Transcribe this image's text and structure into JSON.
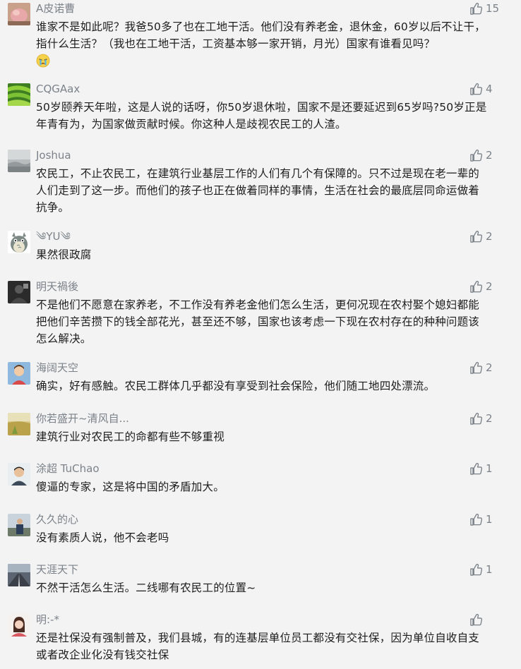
{
  "comments": [
    {
      "name": "A皮诺曹",
      "likes": "15",
      "content": "谁家不是如此呢？我爸50多了也在工地干活。他们没有养老金，退休金，60岁以后不让干，指什么生活？（我也在工地干活，工资基本够一家开销，月光）国家有谁看见吗？",
      "emoji": "crying-face-emoji",
      "avatar": "avatar-pink-object"
    },
    {
      "name": "CQGAax",
      "likes": "4",
      "content": "50岁颐养天年啦，这是人说的话呀，你50岁退休啦，国家不是还要延迟到65岁吗?50岁正是年青有为，为国家做贡献时候。你这种人是歧视农民工的人渣。",
      "avatar": "avatar-green-fields"
    },
    {
      "name": "Joshua",
      "likes": "2",
      "content": "农民工，不止农民工，在建筑行业基层工作的人们有几个有保障的。只不过是现在老一辈的人们走到了这一步。而他们的孩子也正在做着同样的事情，生活在社会的最底层同命运做着抗争。",
      "avatar": "avatar-grey-landscape"
    },
    {
      "name": "༄YU༄",
      "likes": "2",
      "content": "果然很政腐",
      "avatar": "avatar-totoro"
    },
    {
      "name": "明天禍後",
      "likes": "2",
      "content": "不是他们不愿意在家养老，不工作没有养老金他们怎么生活，更何况现在农村娶个媳妇都能把他们辛苦攒下的钱全部花光，甚至还不够，国家也该考虑一下现在农村存在的种种问题该怎么解决。",
      "avatar": "avatar-dark-figure"
    },
    {
      "name": "海阔天空",
      "likes": "2",
      "content": "确实，好有感触。农民工群体几乎都没有享受到社会保险，他们随工地四处漂流。",
      "avatar": "avatar-child-photo"
    },
    {
      "name": "你若盛开~清风自...",
      "likes": "2",
      "content": "建筑行业对农民工的命都有些不够重视",
      "avatar": "avatar-yellow-field"
    },
    {
      "name": "涂超 TuChao",
      "likes": "1",
      "content": "傻逼的专家，这是将中国的矛盾加大。",
      "avatar": "avatar-man-portrait"
    },
    {
      "name": "久久的心",
      "likes": "1",
      "content": "没有素质人说，他不会老吗",
      "avatar": "avatar-person-outdoor"
    },
    {
      "name": "天涯天下",
      "likes": "1",
      "content": "不然干活怎么生活。二线哪有农民工的位置~",
      "avatar": "avatar-road-scene"
    },
    {
      "name": "明:-*",
      "likes": "",
      "content": "还是社保没有强制普及，我们县城，有的连基层单位员工都没有交社保，因为单位自收自支或者改企业化没有钱交社保",
      "avatar": "avatar-woman-portrait"
    }
  ],
  "colors": {
    "background": "#f3f3f3",
    "name": "#7b8289",
    "text": "#1d1d1d",
    "like_icon": "#7b8289"
  },
  "icons": {
    "like": "thumbs-up-icon"
  }
}
